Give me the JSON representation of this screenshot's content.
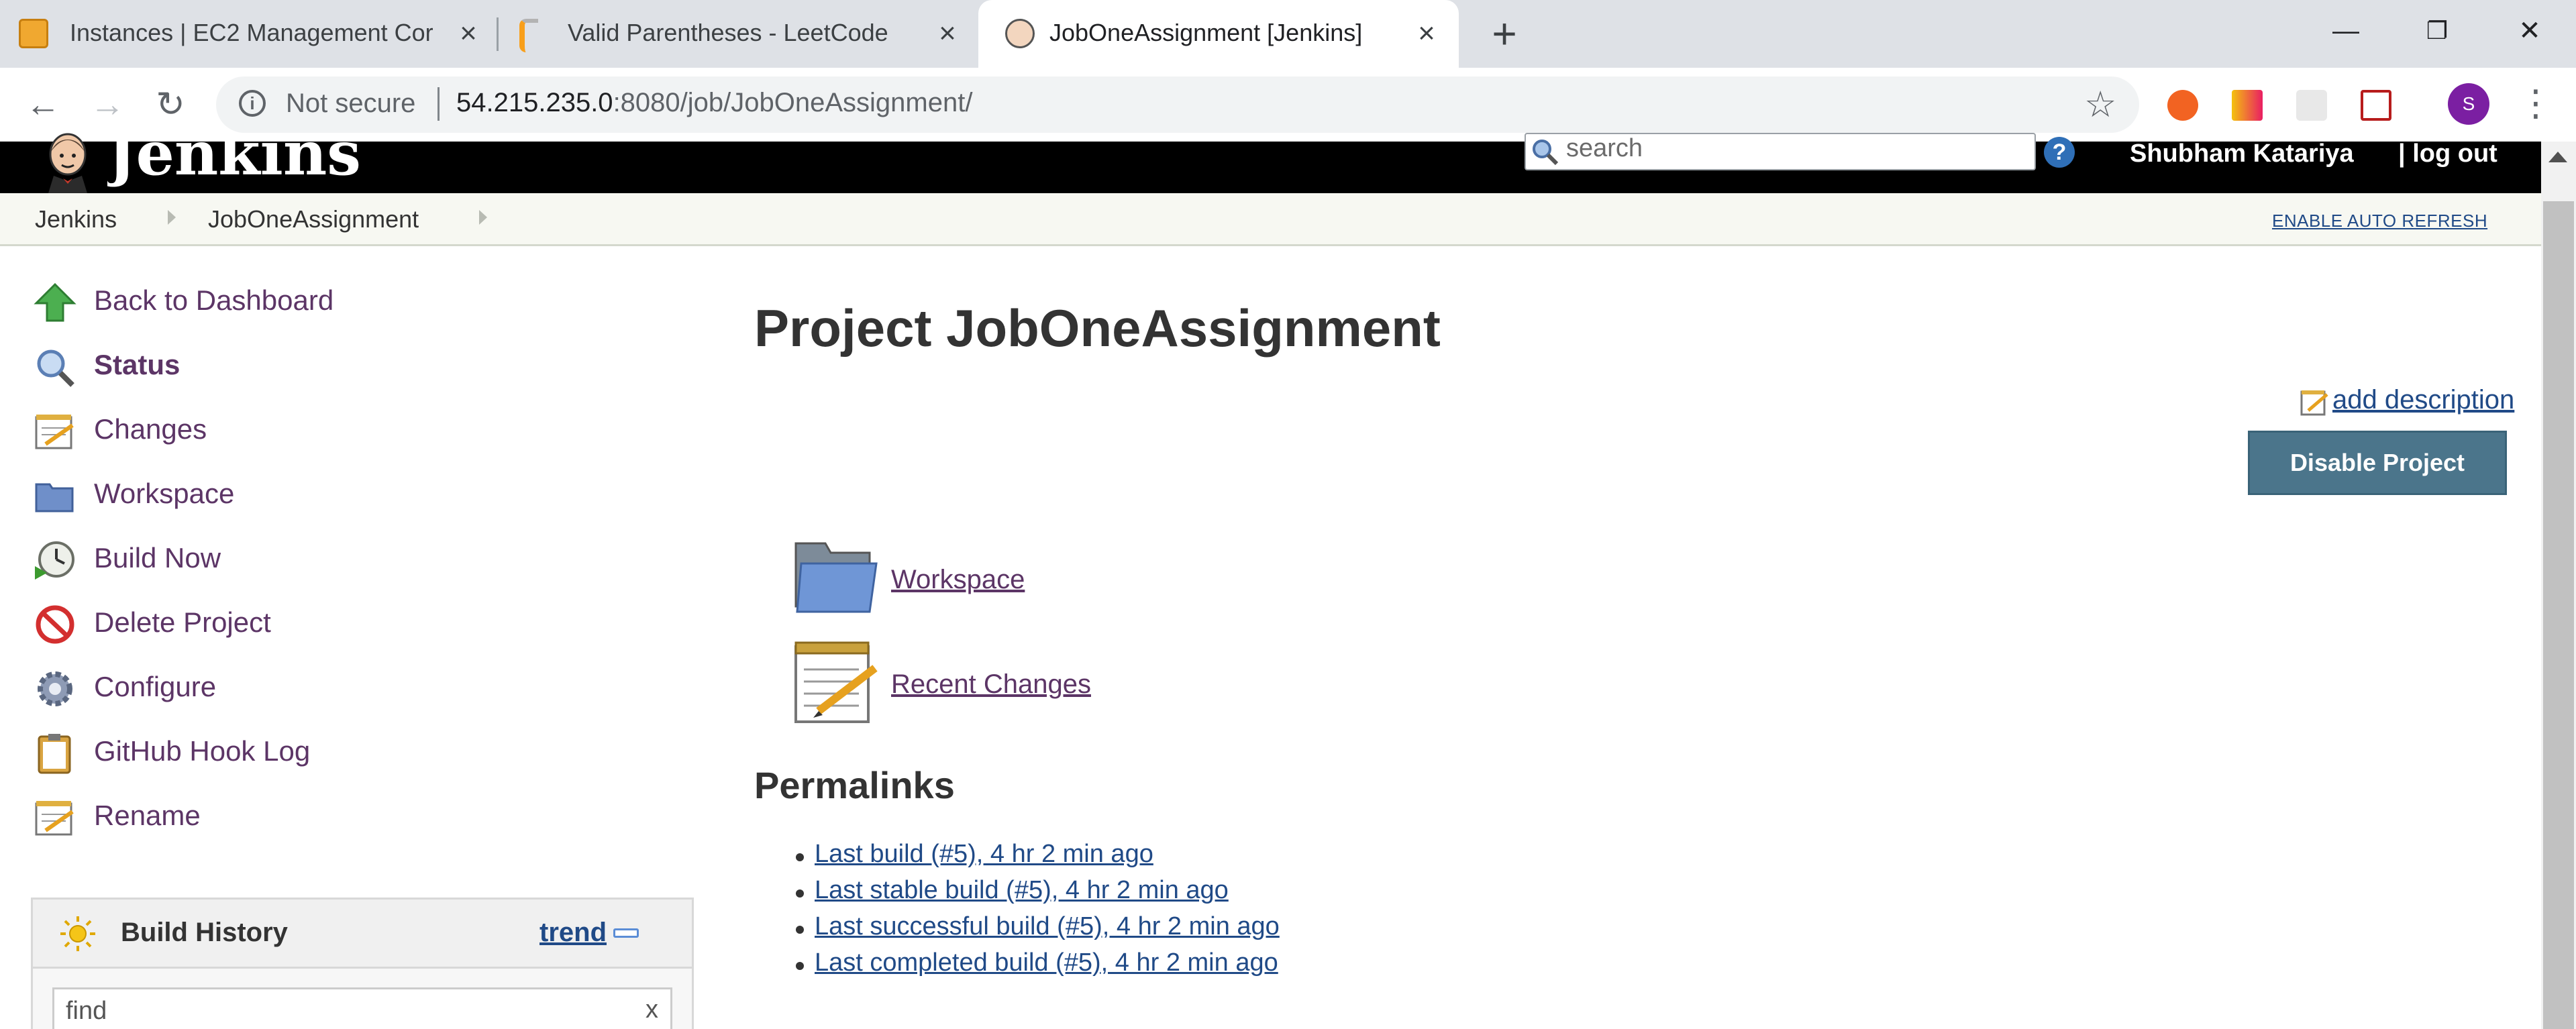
{
  "browser": {
    "tabs": [
      {
        "title": "Instances | EC2 Management Cor",
        "active": false
      },
      {
        "title": "Valid Parentheses - LeetCode",
        "active": false
      },
      {
        "title": "JobOneAssignment [Jenkins]",
        "active": true
      }
    ],
    "security_label": "Not secure",
    "url_host": "54.215.235.0",
    "url_rest": ":8080/job/JobOneAssignment/",
    "profile_initial": "S"
  },
  "jenkins": {
    "logo_text": "Jenkins",
    "search_placeholder": "search",
    "help_label": "?",
    "user_name": "Shubham Katariya",
    "logout_label": "| log out",
    "breadcrumbs": [
      "Jenkins",
      "JobOneAssignment"
    ],
    "auto_refresh": "ENABLE AUTO REFRESH"
  },
  "sidebar": {
    "tasks": [
      {
        "label": "Back to Dashboard",
        "icon": "up-arrow-icon",
        "bold": false
      },
      {
        "label": "Status",
        "icon": "magnifier-icon",
        "bold": true
      },
      {
        "label": "Changes",
        "icon": "notepad-icon",
        "bold": false
      },
      {
        "label": "Workspace",
        "icon": "folder-icon",
        "bold": false
      },
      {
        "label": "Build Now",
        "icon": "clock-icon",
        "bold": false
      },
      {
        "label": "Delete Project",
        "icon": "no-entry-icon",
        "bold": false
      },
      {
        "label": "Configure",
        "icon": "gear-icon",
        "bold": false
      },
      {
        "label": "GitHub Hook Log",
        "icon": "clipboard-icon",
        "bold": false
      },
      {
        "label": "Rename",
        "icon": "notepad-icon",
        "bold": false
      }
    ],
    "build_history": {
      "title": "Build History",
      "trend_label": "trend",
      "find_placeholder": "find",
      "clear_label": "x"
    }
  },
  "main": {
    "title": "Project JobOneAssignment",
    "add_description": "add description",
    "disable_button": "Disable Project",
    "workspace_link": "Workspace",
    "recent_changes_link": "Recent Changes",
    "permalinks_heading": "Permalinks",
    "permalinks": [
      "Last build (#5), 4 hr 2 min ago",
      "Last stable build (#5), 4 hr 2 min ago",
      "Last successful build (#5), 4 hr 2 min ago",
      "Last completed build (#5), 4 hr 2 min ago"
    ]
  },
  "colors": {
    "header_bg": "#000000",
    "link_visited": "#5c3566",
    "link": "#204a87",
    "disable_button_bg": "#4b758b"
  }
}
